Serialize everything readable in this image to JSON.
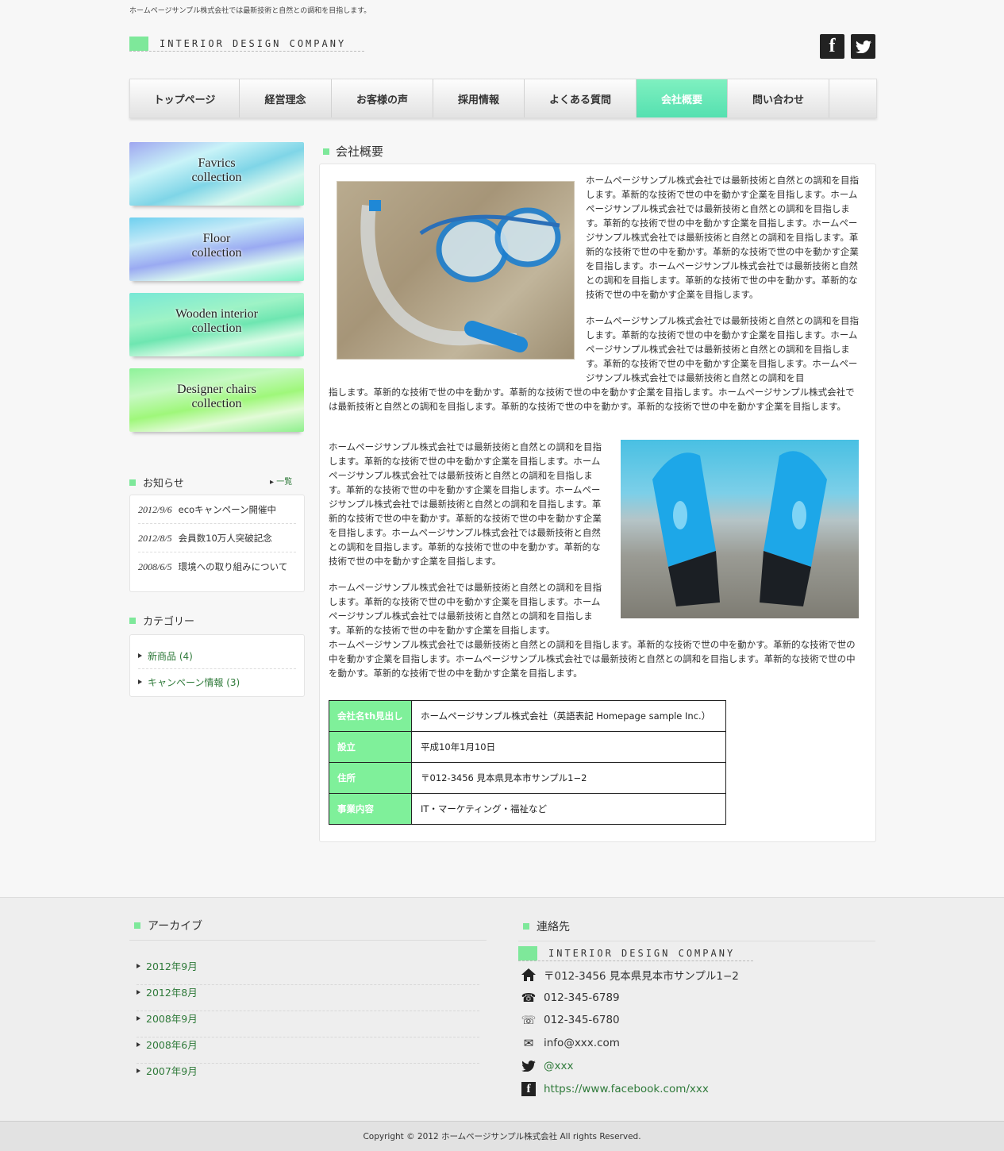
{
  "header": {
    "tagline": "ホームページサンプル株式会社では最新技術と自然との調和を目指します。",
    "logo_text": "INTERIOR DESIGN COMPANY",
    "facebook_glyph": "f",
    "twitter_glyph": "🐦"
  },
  "nav": {
    "items": [
      {
        "label": "トップページ"
      },
      {
        "label": "経営理念"
      },
      {
        "label": "お客様の声"
      },
      {
        "label": "採用情報"
      },
      {
        "label": "よくある質問"
      },
      {
        "label": "会社概要",
        "active": true
      },
      {
        "label": "問い合わせ"
      }
    ]
  },
  "sidebar": {
    "banners": [
      "Favrics\ncollection",
      "Floor\ncollection",
      "Wooden interior\ncollection",
      "Designer chairs\ncollection"
    ],
    "news_heading": "お知らせ",
    "news_more": "一覧",
    "news": [
      {
        "date": "2012/9/6",
        "text": "ecoキャンペーン開催中"
      },
      {
        "date": "2012/8/5",
        "text": "会員数10万人突破記念"
      },
      {
        "date": "2008/6/5",
        "text": "環境への取り組みについて"
      }
    ],
    "category_heading": "カテゴリー",
    "categories": [
      "新商品 (4)",
      "キャンペーン情報 (3)"
    ]
  },
  "main": {
    "title": "会社概要",
    "p1_right": "ホームページサンプル株式会社では最新技術と自然との調和を目指します。革新的な技術で世の中を動かす企業を目指します。ホームページサンプル株式会社では最新技術と自然との調和を目指します。革新的な技術で世の中を動かす企業を目指します。ホームページサンプル株式会社では最新技術と自然との調和を目指します。革新的な技術で世の中を動かす。革新的な技術で世の中を動かす企業を目指します。ホームページサンプル株式会社では最新技術と自然との調和を目指します。革新的な技術で世の中を動かす。革新的な技術で世の中を動かす企業を目指します。",
    "p2_right": "ホームページサンプル株式会社では最新技術と自然との調和を目指します。革新的な技術で世の中を動かす企業を目指します。ホームページサンプル株式会社では最新技術と自然との調和を目指します。革新的な技術で世の中を動かす企業を目指します。ホームページサンプル株式会社では最新技術と自然との調和を目",
    "p2_full": "指します。革新的な技術で世の中を動かす。革新的な技術で世の中を動かす企業を目指します。ホームページサンプル株式会社では最新技術と自然との調和を目指します。革新的な技術で世の中を動かす。革新的な技術で世の中を動かす企業を目指します。",
    "p3_left": "ホームページサンプル株式会社では最新技術と自然との調和を目指します。革新的な技術で世の中を動かす企業を目指します。ホームページサンプル株式会社では最新技術と自然との調和を目指します。革新的な技術で世の中を動かす企業を目指します。ホームページサンプル株式会社では最新技術と自然との調和を目指します。革新的な技術で世の中を動かす。革新的な技術で世の中を動かす企業を目指します。ホームページサンプル株式会社では最新技術と自然との調和を目指します。革新的な技術で世の中を動かす。革新的な技術で世の中を動かす企業を目指します。",
    "p4_left": "ホームページサンプル株式会社では最新技術と自然との調和を目指します。革新的な技術で世の中を動かす企業を目指します。ホームページサンプル株式会社では最新技術と自然との調和を目指します。革新的な技術で世の中を動かす企業を目指します。",
    "p4_full": "ホームページサンプル株式会社では最新技術と自然との調和を目指します。革新的な技術で世の中を動かす。革新的な技術で世の中を動かす企業を目指します。ホームページサンプル株式会社では最新技術と自然との調和を目指します。革新的な技術で世の中を動かす。革新的な技術で世の中を動かす企業を目指します。",
    "table": [
      {
        "th": "会社名th見出し",
        "td": "ホームページサンプル株式会社（英語表記 Homepage sample Inc.）"
      },
      {
        "th": "設立",
        "td": "平成10年1月10日"
      },
      {
        "th": "住所",
        "td": "〒012-3456 見本県見本市サンプル1−2"
      },
      {
        "th": "事業内容",
        "td": "IT・マーケティング・福祉など"
      }
    ]
  },
  "footer": {
    "archive_heading": "アーカイブ",
    "archives": [
      "2012年9月",
      "2012年8月",
      "2008年9月",
      "2008年6月",
      "2007年9月"
    ],
    "contact_heading": "連絡先",
    "logo_text": "INTERIOR DESIGN COMPANY",
    "address": "〒012-3456 見本県見本市サンプル1−2",
    "tel": "012-345-6789",
    "fax": "012-345-6780",
    "email": "info@xxx.com",
    "twitter": "@xxx",
    "facebook": "https://www.facebook.com/xxx",
    "copyright": "Copyright © 2012 ホームページサンプル株式会社 All rights Reserved."
  }
}
